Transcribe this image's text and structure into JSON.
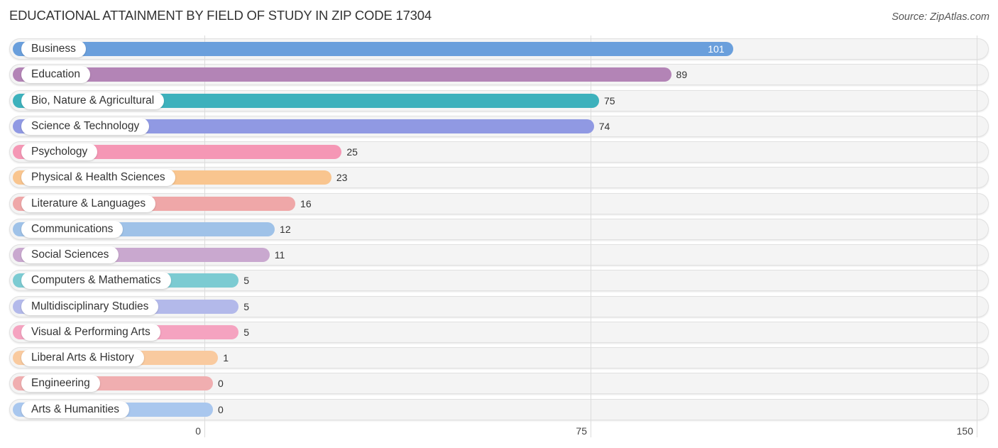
{
  "header": {
    "title": "EDUCATIONAL ATTAINMENT BY FIELD OF STUDY IN ZIP CODE 17304",
    "source": "Source: ZipAtlas.com"
  },
  "chart_data": {
    "type": "bar",
    "orientation": "horizontal",
    "title": "EDUCATIONAL ATTAINMENT BY FIELD OF STUDY IN ZIP CODE 17304",
    "xlabel": "",
    "ylabel": "",
    "xlim": [
      0,
      150
    ],
    "xticks": [
      0,
      75,
      150
    ],
    "grid": true,
    "categories": [
      "Business",
      "Education",
      "Bio, Nature & Agricultural",
      "Science & Technology",
      "Psychology",
      "Physical & Health Sciences",
      "Literature & Languages",
      "Communications",
      "Social Sciences",
      "Computers & Mathematics",
      "Multidisciplinary Studies",
      "Visual & Performing Arts",
      "Liberal Arts & History",
      "Engineering",
      "Arts & Humanities"
    ],
    "values": [
      101,
      89,
      75,
      74,
      25,
      23,
      16,
      12,
      11,
      5,
      5,
      5,
      1,
      0,
      0
    ],
    "colors": [
      "#6a9fdc",
      "#b384b6",
      "#3db1bc",
      "#9099e3",
      "#f597b5",
      "#f9c58f",
      "#efa7a8",
      "#9fc2e8",
      "#c9a8cf",
      "#7ccbd2",
      "#b3b9ea",
      "#f5a3c0",
      "#f9ca9f",
      "#f0aeb0",
      "#a9c7ee"
    ]
  }
}
